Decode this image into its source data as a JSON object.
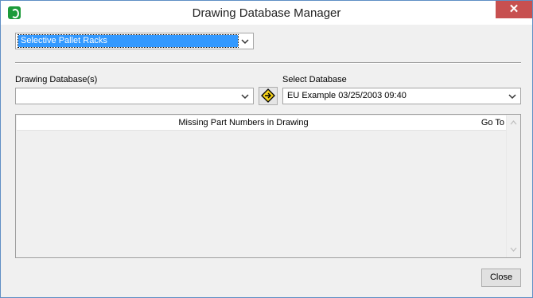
{
  "window": {
    "title": "Drawing Database Manager"
  },
  "rack_type": {
    "selected": "Selective Pallet Racks"
  },
  "drawing_db": {
    "label": "Drawing Database(s)",
    "value": ""
  },
  "select_db": {
    "label": "Select Database",
    "value": "EU Example 03/25/2003 09:40"
  },
  "list": {
    "col_missing": "Missing Part Numbers in Drawing",
    "col_goto": "Go To"
  },
  "buttons": {
    "close": "Close"
  },
  "icons": {
    "app": "app-logo-icon",
    "transfer": "diamond-arrow-icon",
    "dropdown": "chevron-down-icon"
  }
}
